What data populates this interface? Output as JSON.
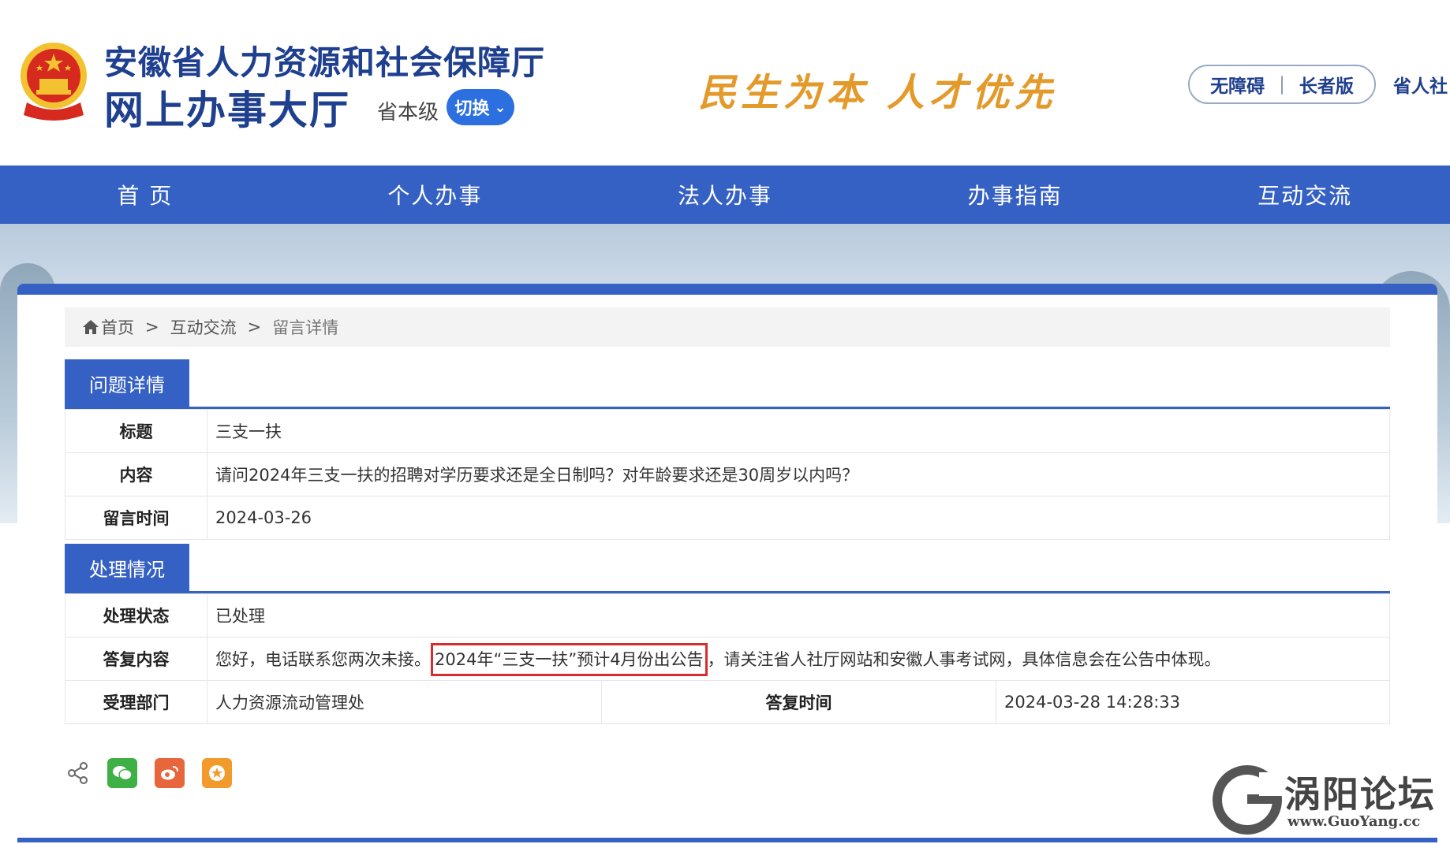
{
  "header": {
    "title_main": "安徽省人力资源和社会保障厅",
    "title_sub": "网上办事大厅",
    "level": "省本级",
    "switch_label": "切换",
    "slogan": "民生为本 人才优先",
    "accessibility": "无障碍",
    "elder_mode": "长者版",
    "site_link": "省人社"
  },
  "nav": {
    "items": [
      {
        "label": "首 页"
      },
      {
        "label": "个人办事"
      },
      {
        "label": "法人办事"
      },
      {
        "label": "办事指南"
      },
      {
        "label": "互动交流"
      }
    ]
  },
  "breadcrumb": {
    "home": "首页",
    "sep": ">",
    "level1": "互动交流",
    "current": "留言详情"
  },
  "question": {
    "section_title": "问题详情",
    "title_label": "标题",
    "title_value": "三支一扶",
    "content_label": "内容",
    "content_value": "请问2024年三支一扶的招聘对学历要求还是全日制吗？对年龄要求还是30周岁以内吗？",
    "time_label": "留言时间",
    "time_value": "2024-03-26"
  },
  "handling": {
    "section_title": "处理情况",
    "status_label": "处理状态",
    "status_value": "已处理",
    "reply_label": "答复内容",
    "reply_prefix": "您好，电话联系您两次未接。",
    "reply_highlight": "2024年“三支一扶”预计4月份出公告",
    "reply_suffix": "，请关注省人社厅网站和安徽人事考试网，具体信息会在公告中体现。",
    "dept_label": "受理部门",
    "dept_value": "人力资源流动管理处",
    "reply_time_label": "答复时间",
    "reply_time_value": "2024-03-28 14:28:33"
  },
  "watermark": {
    "name": "涡阳论坛",
    "url": "www.GuoYang.cc"
  },
  "colors": {
    "primary": "#3561c4",
    "title": "#1f3f8f",
    "slogan": "#e39a2b",
    "highlight": "#d72d2d"
  }
}
